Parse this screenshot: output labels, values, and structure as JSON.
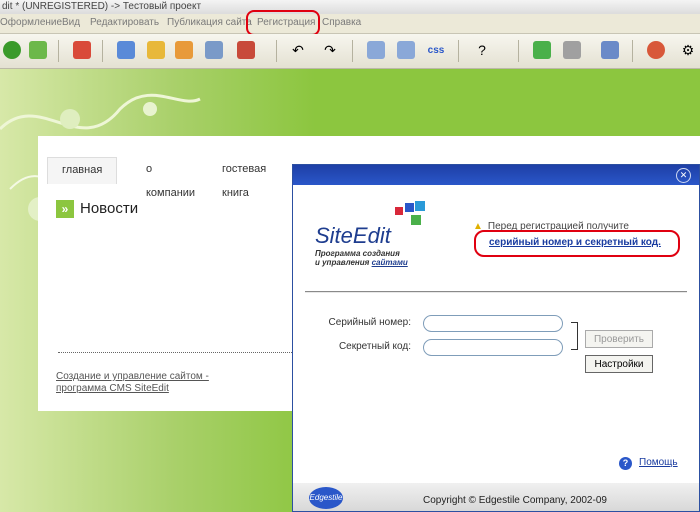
{
  "window": {
    "title": "dit * (UNREGISTERED) -> Тестовый проект"
  },
  "menu": {
    "items": [
      "Оформление",
      "Вид",
      "Редактировать",
      "Публикация сайта",
      "Регистрация",
      "Справка"
    ]
  },
  "toolbar": {
    "buttons": [
      "go-icon",
      "refresh-icon",
      "puzzle-icon",
      "page-icon",
      "folder-icon",
      "rss-icon",
      "form-icon",
      "email-icon",
      "undo-icon",
      "redo-icon",
      "layout-icon",
      "layout2-icon",
      "css-icon",
      "help-icon",
      "add-page-icon",
      "edit-page-icon",
      "structure-icon",
      "palette-icon",
      "gear-icon"
    ],
    "css_label": "css"
  },
  "site": {
    "nav": [
      "главная",
      "о компании",
      "гостевая книга"
    ],
    "news_title": "Новости",
    "footer_link_line1": "Создание и управление сайтом -",
    "footer_link_line2": "программа CMS SiteEdit"
  },
  "dialog": {
    "logo_text": "SiteEdit",
    "logo_sub1": "Программа создания",
    "logo_sub2_prefix": "и управления ",
    "logo_sub2_link": "сайтами",
    "warning": "Перед регистрацией получите",
    "serial_link": "серийный номер и секретный код.",
    "serial_label": "Серийный номер:",
    "secret_label": "Секретный код:",
    "serial_value": "",
    "secret_value": "",
    "check_button": "Проверить",
    "settings_button": "Настройки",
    "help_link": "Помощь",
    "copyright": "Copyright © Edgestile Company, 2002-09",
    "footer_logo": "Edgestile"
  },
  "colors": {
    "accent_green": "#8cc63f",
    "dialog_blue": "#2a57c9",
    "highlight_red": "#e00010"
  }
}
